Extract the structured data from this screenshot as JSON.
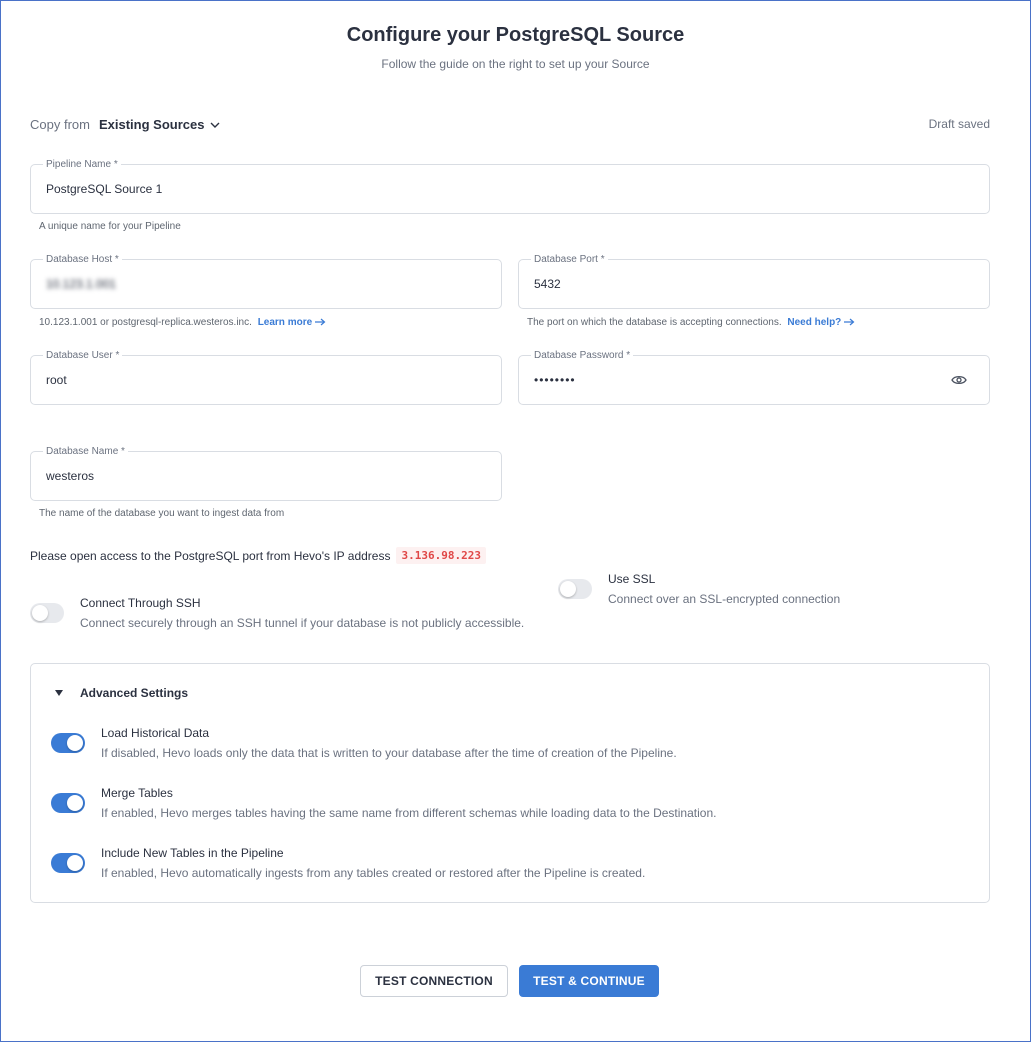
{
  "header": {
    "title": "Configure your PostgreSQL Source",
    "subtitle": "Follow the guide on the right to set up your Source"
  },
  "copy_from": {
    "label": "Copy from",
    "dropdown_label": "Existing Sources"
  },
  "draft_status": "Draft saved",
  "fields": {
    "pipeline_name": {
      "label": "Pipeline Name *",
      "value": "PostgreSQL Source 1",
      "hint": "A unique name for your Pipeline"
    },
    "database_host": {
      "label": "Database Host *",
      "value": "10.123.1.001",
      "hint": "10.123.1.001 or postgresql-replica.westeros.inc.",
      "hint_link": "Learn more"
    },
    "database_port": {
      "label": "Database Port *",
      "value": "5432",
      "hint": "The port on which the database is accepting connections.",
      "hint_link": "Need help?"
    },
    "database_user": {
      "label": "Database User *",
      "value": "root"
    },
    "database_password": {
      "label": "Database Password *",
      "value": "••••••••"
    },
    "database_name": {
      "label": "Database Name *",
      "value": "westeros",
      "hint": "The name of the database you want to ingest data from"
    }
  },
  "ip_notice": {
    "text": "Please open access to the PostgreSQL port from Hevo's IP address",
    "ip": "3.136.98.223"
  },
  "options": {
    "ssh": {
      "title": "Connect Through SSH",
      "description": "Connect securely through an SSH tunnel if your database is not publicly accessible.",
      "enabled": false
    },
    "ssl": {
      "title": "Use SSL",
      "description": "Connect over an SSL-encrypted connection",
      "enabled": false
    }
  },
  "advanced": {
    "title": "Advanced Settings",
    "items": [
      {
        "title": "Load Historical Data",
        "description": "If disabled, Hevo loads only the data that is written to your database after the time of creation of the Pipeline.",
        "enabled": true
      },
      {
        "title": "Merge Tables",
        "description": "If enabled, Hevo merges tables having the same name from different schemas while loading data to the Destination.",
        "enabled": true
      },
      {
        "title": "Include New Tables in the Pipeline",
        "description": "If enabled, Hevo automatically ingests from any tables created or restored after the Pipeline is created.",
        "enabled": true
      }
    ]
  },
  "buttons": {
    "test_connection": "TEST CONNECTION",
    "test_continue": "TEST & CONTINUE"
  },
  "colors": {
    "accent": "#3a7bd5",
    "ip_text": "#e04848",
    "ip_background": "#fdf1f1"
  }
}
